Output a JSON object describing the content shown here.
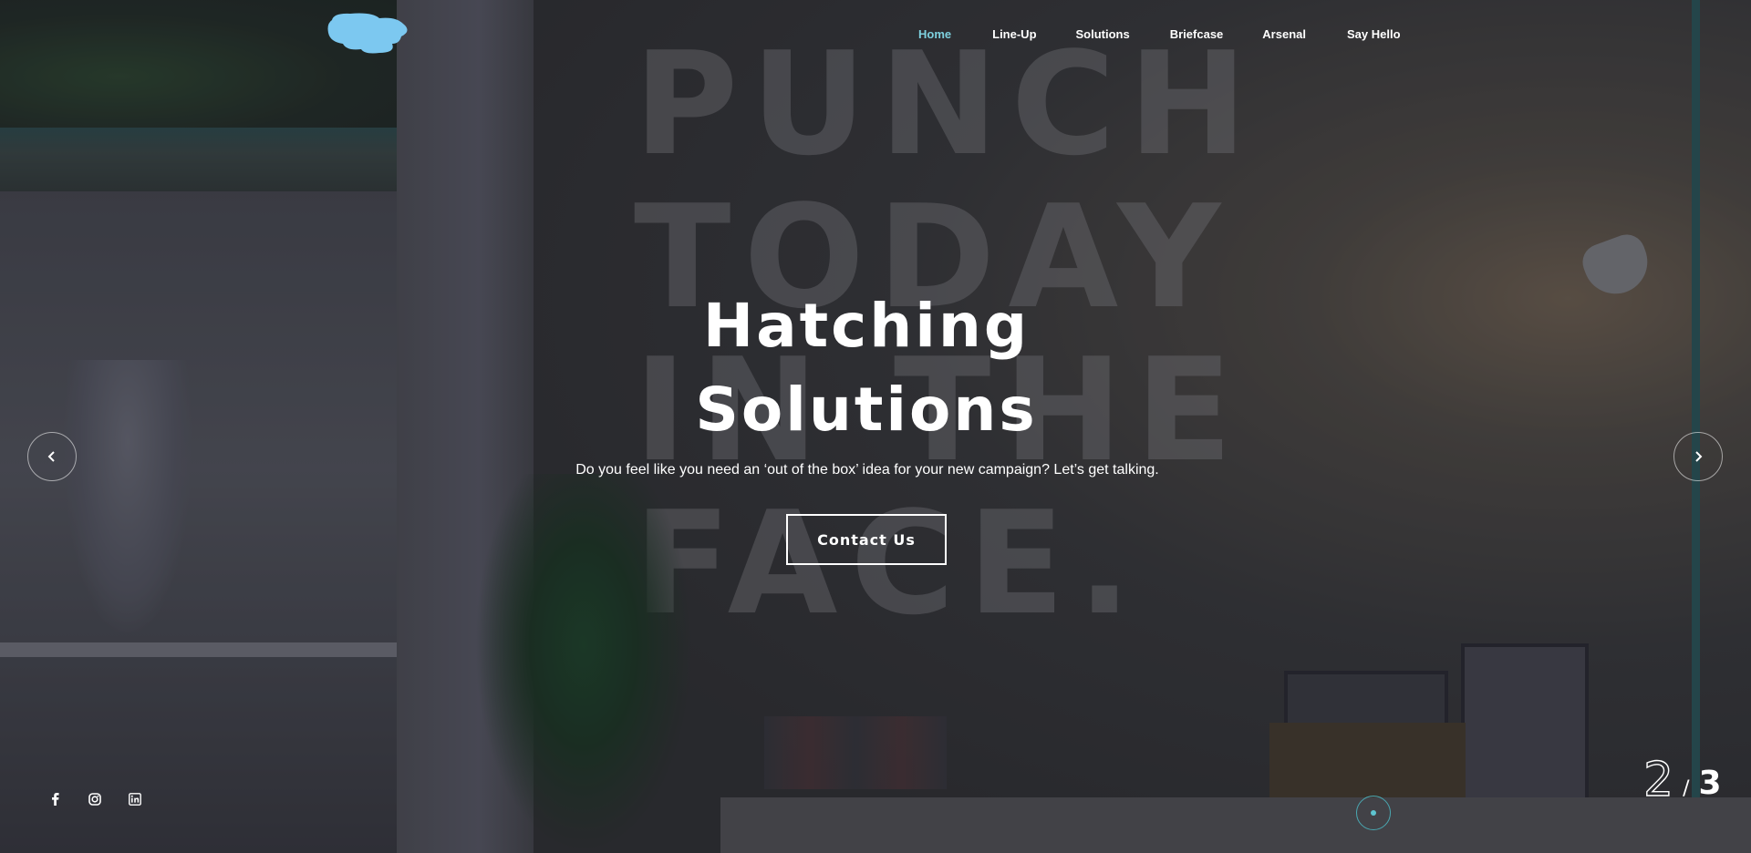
{
  "header": {
    "nav": [
      {
        "label": "Home",
        "active": true
      },
      {
        "label": "Line-Up",
        "active": false
      },
      {
        "label": "Solutions",
        "active": false
      },
      {
        "label": "Briefcase",
        "active": false
      },
      {
        "label": "Arsenal",
        "active": false
      },
      {
        "label": "Say Hello",
        "active": false
      }
    ]
  },
  "background": {
    "wall_text": "PUNCH\nTODAY\nIN THE\nFACE."
  },
  "hero": {
    "headline_line1": "Hatching",
    "headline_line2": "Solutions",
    "subtitle": "Do you feel like you need an ‘out of the box’ idea for your new campaign? Let’s get talking.",
    "cta_label": "Contact Us"
  },
  "slider": {
    "prev_icon": "chevron-left-icon",
    "next_icon": "chevron-right-icon",
    "current": "2",
    "separator": "/",
    "total": "3"
  },
  "socials": [
    "facebook-icon",
    "instagram-icon",
    "linkedin-icon"
  ],
  "colors": {
    "accent": "#7dd0de",
    "scroll_indicator": "#4aa7b1",
    "text": "#ffffff",
    "logo": "#7cc8f0"
  }
}
